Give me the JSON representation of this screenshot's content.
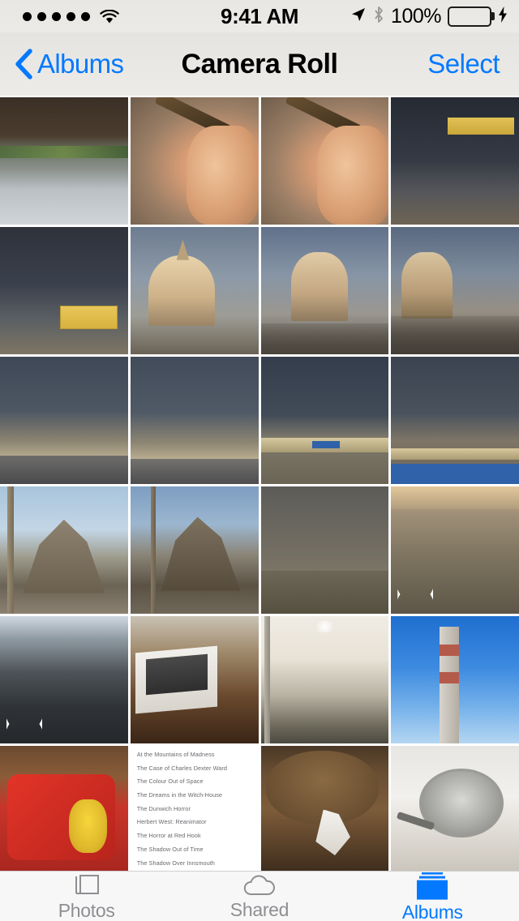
{
  "statusbar": {
    "signal_dots": 5,
    "wifi_icon": "wifi-icon",
    "time": "9:41 AM",
    "location_icon": "location-arrow-icon",
    "bluetooth_icon": "bluetooth-icon",
    "battery_percent": "100%",
    "battery_color": "#4cd661",
    "charging_icon": "lightning-bolt-icon"
  },
  "navbar": {
    "back_icon": "chevron-left-icon",
    "back_label": "Albums",
    "title": "Camera Roll",
    "select_label": "Select",
    "accent_color": "#0479ff"
  },
  "grid": {
    "columns": 4,
    "photos": [
      {
        "art": "a-river",
        "name": "photo-river-rocks",
        "badge": null
      },
      {
        "art": "a-cigar",
        "name": "photo-hand-holding-cigar",
        "badge": null
      },
      {
        "art": "a-cigar",
        "name": "photo-hand-holding-cigar-2",
        "badge": null
      },
      {
        "art": "a-billboard2",
        "name": "photo-billboard-dark-sky",
        "badge": null
      },
      {
        "art": "a-billboard",
        "name": "photo-billboard-street",
        "badge": null
      },
      {
        "art": "a-church",
        "name": "photo-cathedral-dome",
        "badge": null
      },
      {
        "art": "a-church2",
        "name": "photo-cathedral-dome-2",
        "badge": null
      },
      {
        "art": "a-church3",
        "name": "photo-cathedral-street",
        "badge": null
      },
      {
        "art": "a-road",
        "name": "photo-stormy-road",
        "badge": null
      },
      {
        "art": "a-road2",
        "name": "photo-stormy-road-2",
        "badge": null
      },
      {
        "art": "a-bridge",
        "name": "photo-overpass-bridge",
        "badge": null
      },
      {
        "art": "a-bridge2",
        "name": "photo-overpass-bridge-2",
        "badge": null
      },
      {
        "art": "a-rock",
        "name": "photo-eagle-rock-monument",
        "badge": null
      },
      {
        "art": "a-rock2",
        "name": "photo-eagle-rock-monument-2",
        "badge": null
      },
      {
        "art": "a-hill",
        "name": "photo-rocky-hillside",
        "badge": null
      },
      {
        "art": "a-hill2",
        "name": "photo-rocky-hillside-2",
        "badge": "panorama"
      },
      {
        "art": "a-dark",
        "name": "photo-dark-field",
        "badge": "panorama"
      },
      {
        "art": "a-laptopbox",
        "name": "photo-laptop-box-desk",
        "badge": null
      },
      {
        "art": "a-fog",
        "name": "photo-foggy-window",
        "badge": null
      },
      {
        "art": "a-chimney",
        "name": "photo-industrial-chimney",
        "badge": null
      },
      {
        "art": "a-snack",
        "name": "photo-snack-package",
        "badge": null
      },
      {
        "art": "a-booklist",
        "name": "photo-book-title-list",
        "badge": null
      },
      {
        "art": "a-table",
        "name": "photo-food-on-table",
        "badge": null
      },
      {
        "art": "a-stove",
        "name": "photo-pan-on-stove",
        "badge": null
      }
    ],
    "book_titles": [
      "At the Mountains of Madness",
      "The Case of Charles Dexter Ward",
      "The Colour Out of Space",
      "The Dreams in the Witch-House",
      "The Dunwich Horror",
      "Herbert West: Reanimator",
      "The Horror at Red Hook",
      "The Shadow Out of Time",
      "The Shadow Over Innsmouth"
    ]
  },
  "tabbar": {
    "tabs": [
      {
        "label": "Photos",
        "icon": "photos-stack-icon",
        "active": false
      },
      {
        "label": "Shared",
        "icon": "cloud-icon",
        "active": false
      },
      {
        "label": "Albums",
        "icon": "albums-icon",
        "active": true
      }
    ],
    "active_color": "#0479ff",
    "inactive_color": "#8e8e93"
  }
}
